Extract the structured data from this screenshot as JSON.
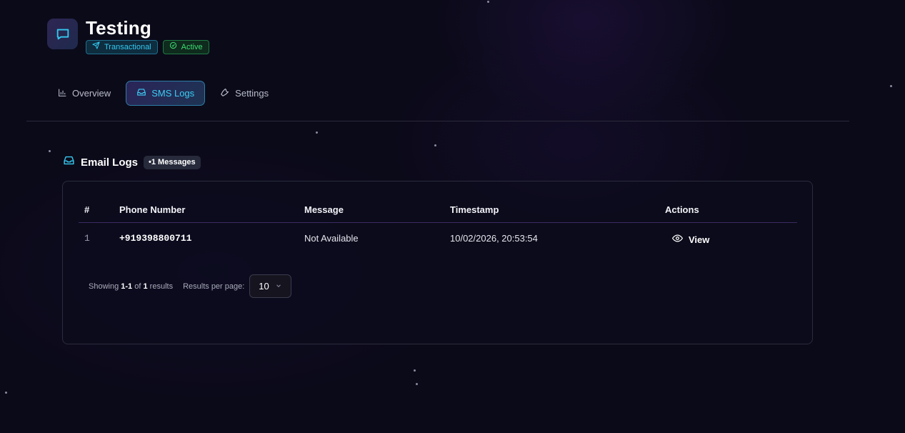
{
  "header": {
    "title": "Testing",
    "badges": {
      "type": "Transactional",
      "status": "Active"
    }
  },
  "tabs": [
    {
      "label": "Overview",
      "icon": "bar-chart-icon",
      "active": false
    },
    {
      "label": "SMS Logs",
      "icon": "inbox-icon",
      "active": true
    },
    {
      "label": "Settings",
      "icon": "wrench-icon",
      "active": false
    }
  ],
  "section": {
    "title": "Email Logs",
    "count_badge": "•1 Messages"
  },
  "table": {
    "columns": [
      "#",
      "Phone Number",
      "Message",
      "Timestamp",
      "Actions"
    ],
    "rows": [
      {
        "index": "1",
        "phone": "+919398800711",
        "message": "Not Available",
        "timestamp": "10/02/2026, 20:53:54",
        "action": "View"
      }
    ]
  },
  "pagination": {
    "showing_prefix": "Showing",
    "range": "1-1",
    "of": "of",
    "total": "1",
    "suffix": "results",
    "per_page_label": "Results per page:",
    "per_page_value": "10"
  },
  "colors": {
    "background": "#0b0a19",
    "accent_cyan": "#35c9f0",
    "active_green": "#3ddc72",
    "divider_purple": "#3b2a63"
  }
}
